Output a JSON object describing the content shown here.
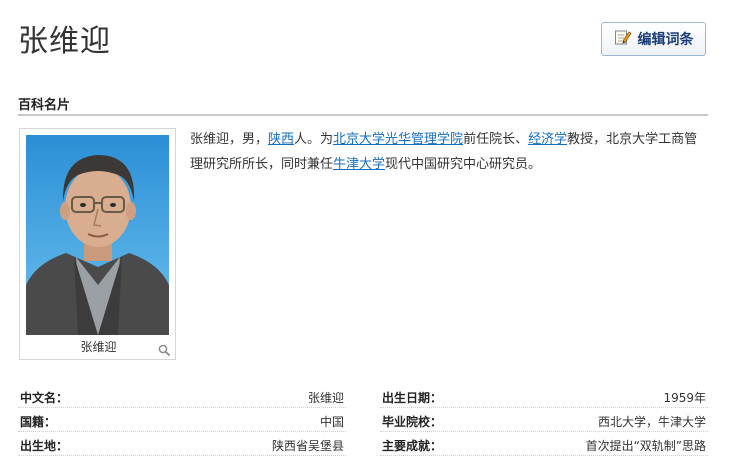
{
  "header": {
    "title": "张维迎",
    "edit_label": "编辑词条",
    "edit_icon": "edit-pencil-icon"
  },
  "card": {
    "section_title": "百科名片",
    "photo_caption": "张维迎",
    "summary": {
      "p1": "张维迎，男，",
      "link1": "陕西",
      "p2": "人。为",
      "link2": "北京大学光华管理学院",
      "p3": "前任院长、",
      "link3": "经济学",
      "p4": "教授，北京大学工商管理研究所所长，同时兼任",
      "link4": "牛津大学",
      "p5": "现代中国研究中心研究员。"
    }
  },
  "info": {
    "left": [
      {
        "key": "中文名：",
        "value": "张维迎"
      },
      {
        "key": "国籍：",
        "value": "中国"
      },
      {
        "key": "出生地：",
        "value": "陕西省吴堡县"
      }
    ],
    "right": [
      {
        "key": "出生日期：",
        "value": "1959年"
      },
      {
        "key": "毕业院校：",
        "value": "西北大学，牛津大学"
      },
      {
        "key": "主要成就：",
        "value": "首次提出“双轨制”思路"
      }
    ]
  },
  "colors": {
    "link": "#136ec2",
    "button_text": "#1a3e7a"
  }
}
